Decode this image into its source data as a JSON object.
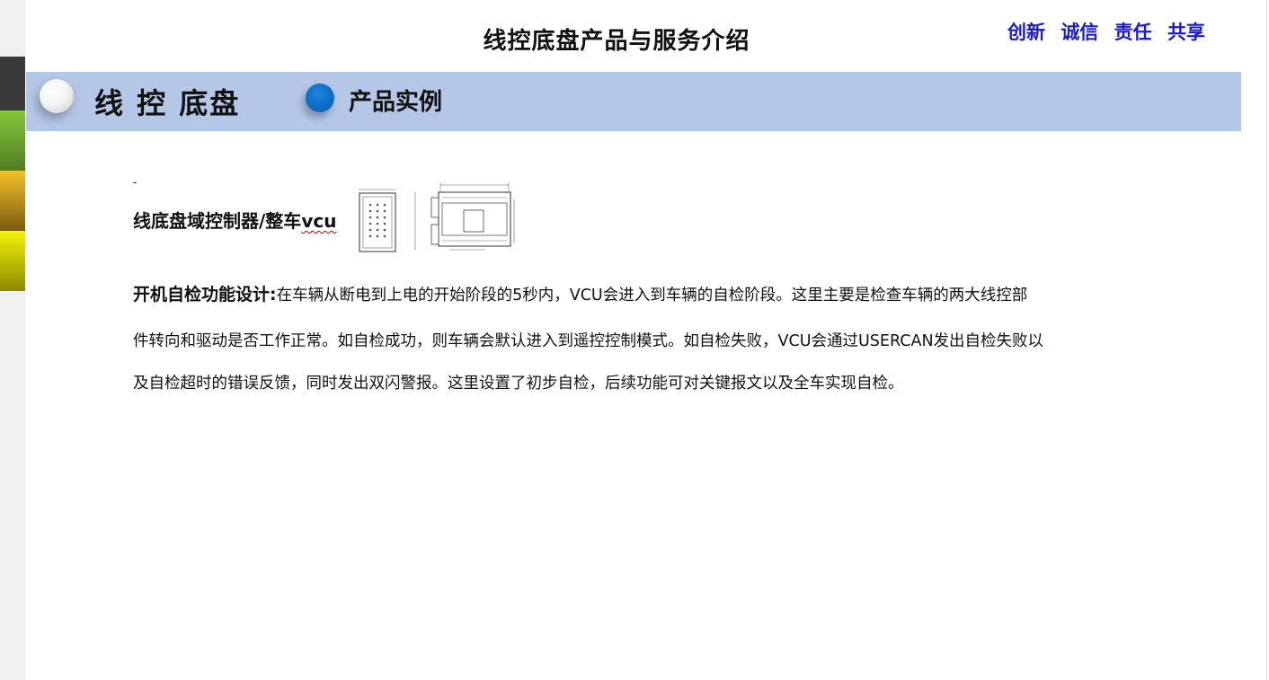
{
  "header": {
    "title": "线控底盘产品与服务介绍",
    "slogans": [
      "创新",
      "诚信",
      "责任",
      "共享"
    ]
  },
  "banner": {
    "title": "线 控 底盘",
    "subtitle": "产品实例"
  },
  "colors": {
    "banner_bg": "#b4c7e7",
    "slogan_text": "#1a1ad0",
    "accent_ball": "#0b6cc4"
  },
  "product": {
    "dash": "-",
    "name_prefix": "线底盘域控制器/整车",
    "name_suffix": "vcu"
  },
  "description": {
    "heading": "开机自检功能设计:",
    "line1_rest": "在车辆从断电到上电的开始阶段的5秒内，VCU会进入到车辆的自检阶段。这里主要是检查车辆的两大线控部",
    "line2": "件转向和驱动是否工作正常。如自检成功，则车辆会默认进入到遥控控制模式。如自检失败，VCU会通过USERCAN发出自检失败以",
    "line3": "及自检超时的错误反馈，同时发出双闪警报。这里设置了初步自检，后续功能可对关键报文以及全车实现自检。"
  }
}
